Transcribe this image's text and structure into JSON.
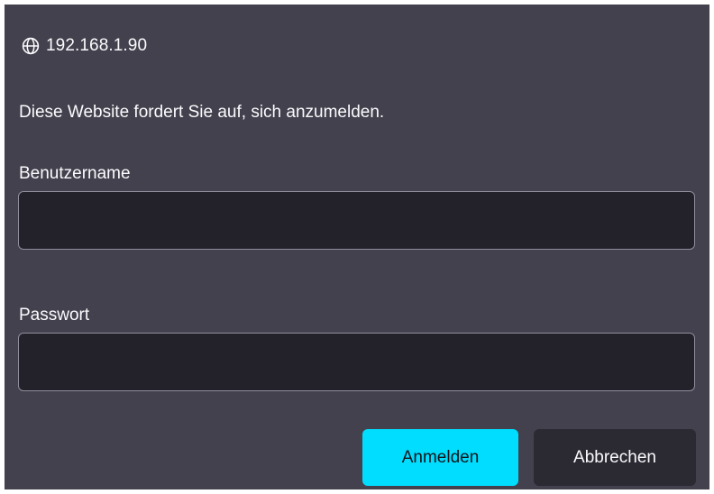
{
  "dialog": {
    "host": "192.168.1.90",
    "host_icon": "globe-icon",
    "message": "Diese Website fordert Sie auf, sich anzumelden.",
    "username": {
      "label": "Benutzername",
      "value": "",
      "placeholder": ""
    },
    "password": {
      "label": "Passwort",
      "value": "",
      "placeholder": ""
    },
    "buttons": {
      "login_label": "Anmelden",
      "cancel_label": "Abbrechen"
    }
  },
  "colors": {
    "dialog_background": "#42414d",
    "field_background": "#23222b",
    "field_border": "#8f8f9d",
    "text": "#fbfbfe",
    "primary_button": "#00ddff",
    "secondary_button": "#2b2a33"
  }
}
